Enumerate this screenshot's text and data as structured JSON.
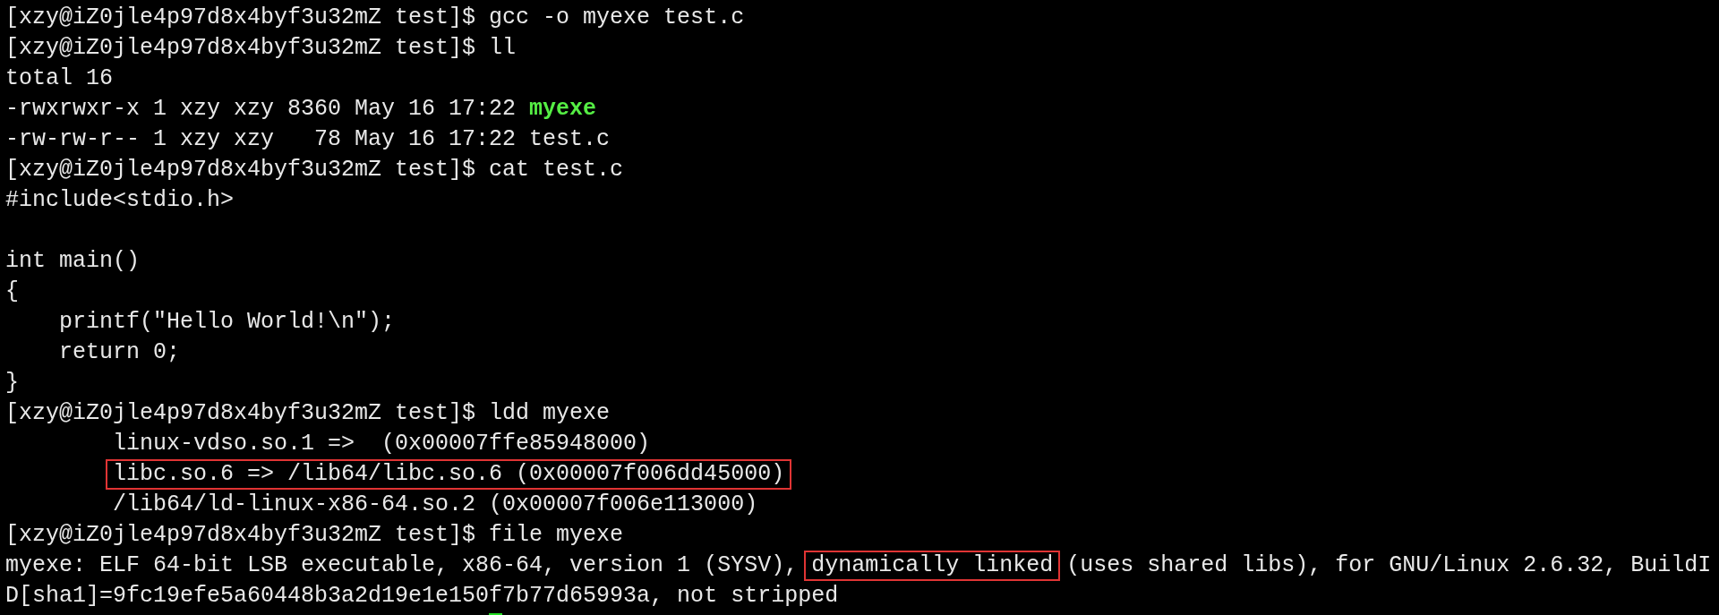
{
  "terminal": {
    "lines": [
      {
        "kind": "text",
        "segments": [
          {
            "kind": "plain",
            "text": "[xzy@iZ0jle4p97d8x4byf3u32mZ test]$ gcc -o myexe test.c"
          }
        ]
      },
      {
        "kind": "text",
        "segments": [
          {
            "kind": "plain",
            "text": "[xzy@iZ0jle4p97d8x4byf3u32mZ test]$ ll"
          }
        ]
      },
      {
        "kind": "text",
        "segments": [
          {
            "kind": "plain",
            "text": "total 16"
          }
        ]
      },
      {
        "kind": "text",
        "segments": [
          {
            "kind": "plain",
            "text": "-rwxrwxr-x 1 xzy xzy 8360 May 16 17:22 "
          },
          {
            "kind": "executable",
            "text": "myexe"
          }
        ]
      },
      {
        "kind": "text",
        "segments": [
          {
            "kind": "plain",
            "text": "-rw-rw-r-- 1 xzy xzy   78 May 16 17:22 test.c"
          }
        ]
      },
      {
        "kind": "text",
        "segments": [
          {
            "kind": "plain",
            "text": "[xzy@iZ0jle4p97d8x4byf3u32mZ test]$ cat test.c"
          }
        ]
      },
      {
        "kind": "text",
        "segments": [
          {
            "kind": "plain",
            "text": "#include<stdio.h>"
          }
        ]
      },
      {
        "kind": "blank"
      },
      {
        "kind": "text",
        "segments": [
          {
            "kind": "plain",
            "text": "int main()"
          }
        ]
      },
      {
        "kind": "text",
        "segments": [
          {
            "kind": "plain",
            "text": "{"
          }
        ]
      },
      {
        "kind": "text",
        "segments": [
          {
            "kind": "plain",
            "text": "    printf(\"Hello World!\\n\");"
          }
        ]
      },
      {
        "kind": "text",
        "segments": [
          {
            "kind": "plain",
            "text": "    return 0;"
          }
        ]
      },
      {
        "kind": "text",
        "segments": [
          {
            "kind": "plain",
            "text": "}"
          }
        ]
      },
      {
        "kind": "text",
        "segments": [
          {
            "kind": "plain",
            "text": "[xzy@iZ0jle4p97d8x4byf3u32mZ test]$ ldd myexe"
          }
        ]
      },
      {
        "kind": "text",
        "segments": [
          {
            "kind": "tab"
          },
          {
            "kind": "plain",
            "text": "linux-vdso.so.1 =>  (0x00007ffe85948000)"
          }
        ]
      },
      {
        "kind": "text",
        "segments": [
          {
            "kind": "tab"
          },
          {
            "kind": "boxed",
            "text": "libc.so.6 => /lib64/libc.so.6 (0x00007f006dd45000)"
          }
        ]
      },
      {
        "kind": "text",
        "segments": [
          {
            "kind": "tab"
          },
          {
            "kind": "plain",
            "text": "/lib64/ld-linux-x86-64.so.2 (0x00007f006e113000)"
          }
        ]
      },
      {
        "kind": "text",
        "segments": [
          {
            "kind": "plain",
            "text": "[xzy@iZ0jle4p97d8x4byf3u32mZ test]$ file myexe"
          }
        ]
      },
      {
        "kind": "text",
        "segments": [
          {
            "kind": "plain",
            "text": "myexe: ELF 64-bit LSB executable, x86-64, version 1 (SYSV), "
          },
          {
            "kind": "boxed",
            "text": "dynamically linked"
          },
          {
            "kind": "plain",
            "text": " (uses shared libs), for GNU/Linux 2.6.32, BuildI"
          }
        ]
      },
      {
        "kind": "text",
        "segments": [
          {
            "kind": "plain",
            "text": "D[sha1]=9fc19efe5a60448b3a2d19e1e150f7b77d65993a, not stripped"
          }
        ]
      }
    ]
  }
}
